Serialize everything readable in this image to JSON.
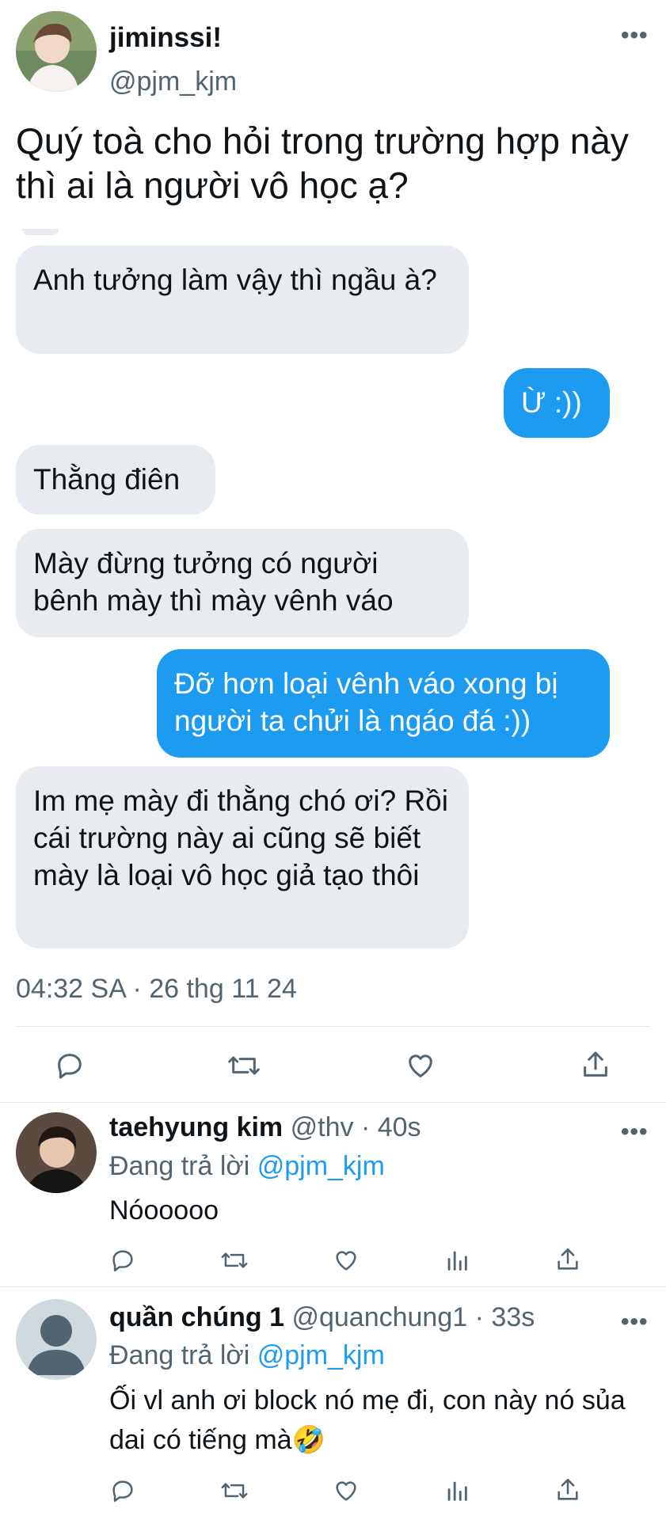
{
  "tweet": {
    "display_name": "jiminssi!",
    "handle": "@pjm_kjm",
    "text": "Quý toà cho hỏi trong trường hợp này thì ai là người vô học ạ?",
    "timestamp": "04:32 SA · 26 thg 11 24"
  },
  "chat": {
    "messages": [
      {
        "side": "in",
        "text": "Anh tưởng làm vậy thì ngầu à?"
      },
      {
        "side": "out",
        "text": "Ừ :))"
      },
      {
        "side": "in",
        "text": "Thằng điên"
      },
      {
        "side": "in",
        "text": "Mày đừng tưởng có người bênh mày thì mày vênh váo"
      },
      {
        "side": "out",
        "text": "Đỡ hơn loại vênh váo xong bị người ta chửi là ngáo đá :))"
      },
      {
        "side": "in",
        "text": "Im mẹ mày đi thằng chó ơi? Rồi cái trường này ai cũng sẽ biết mày là loại vô học giả tạo thôi"
      }
    ]
  },
  "replies": [
    {
      "display_name": "taehyung kim",
      "handle": "@thv",
      "time": "· 40s",
      "replying_prefix": "Đang trả lời",
      "replying_to": "@pjm_kjm",
      "text": "Nóooooo"
    },
    {
      "display_name": "quần chúng 1",
      "handle": "@quanchung1",
      "time": "· 33s",
      "replying_prefix": "Đang trả lời",
      "replying_to": "@pjm_kjm",
      "text": "Ối vl anh ơi block nó mẹ đi, con này nó sủa dai có tiếng mà🤣"
    }
  ],
  "icons": {
    "more": "more-icon",
    "reply": "reply-icon",
    "retweet": "retweet-icon",
    "like": "like-icon",
    "views": "views-icon",
    "share": "share-icon"
  },
  "colors": {
    "accent": "#1d9bf0",
    "incoming_bubble": "#e8ebef",
    "muted_text": "#536471"
  }
}
